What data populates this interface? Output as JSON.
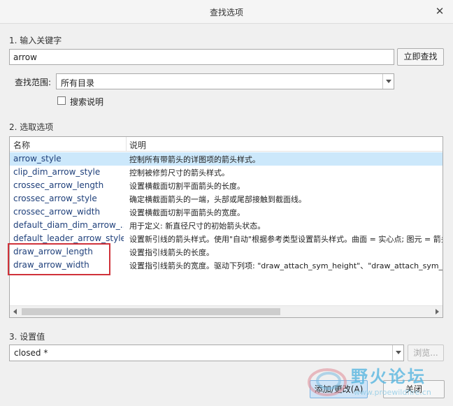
{
  "window": {
    "title": "查找选项",
    "close_glyph": "✕"
  },
  "section1": {
    "label": "1. 输入关键字",
    "keyword_value": "arrow",
    "search_button": "立即查找",
    "scope_label": "查找范围:",
    "scope_value": "所有目录",
    "search_desc_label": "搜索说明"
  },
  "section2": {
    "label": "2. 选取选项",
    "columns": {
      "name": "名称",
      "desc": "说明"
    },
    "rows": [
      {
        "name": "arrow_style",
        "desc": "控制所有带箭头的详图项的箭头样式。"
      },
      {
        "name": "clip_dim_arrow_style",
        "desc": "控制被修剪尺寸的箭头样式。"
      },
      {
        "name": "crossec_arrow_length",
        "desc": "设置横截面切割平面箭头的长度。"
      },
      {
        "name": "crossec_arrow_style",
        "desc": "确定横截面箭头的一端，头部或尾部接触到截面线。"
      },
      {
        "name": "crossec_arrow_width",
        "desc": "设置横截面切割平面箭头的宽度。"
      },
      {
        "name": "default_diam_dim_arrow_...",
        "desc": "用于定义: 新直径尺寸的初始箭头状态。"
      },
      {
        "name": "default_leader_arrow_style",
        "desc": "设置新引线的箭头样式。使用\"自动\"根据参考类型设置箭头样式。曲面 = 实心点; 图元 = 箭头"
      },
      {
        "name": "draw_arrow_length",
        "desc": "设置指引线箭头的长度。"
      },
      {
        "name": "draw_arrow_width",
        "desc": "设置指引线箭头的宽度。驱动下列项: \"draw_attach_sym_height\"、\"draw_attach_sym_width\""
      }
    ],
    "selected_index": 0
  },
  "section3": {
    "label": "3. 设置值",
    "value": "closed *",
    "browse_button": "浏览..."
  },
  "footer": {
    "add_button": "添加/更改(A)",
    "close_button": "关闭"
  },
  "watermark": {
    "text": "野火论坛",
    "url": "www.proewildfire.cn"
  },
  "colors": {
    "selection": "#cce8fb",
    "highlight_box": "#d0323a",
    "link_text": "#1e3f7a"
  }
}
